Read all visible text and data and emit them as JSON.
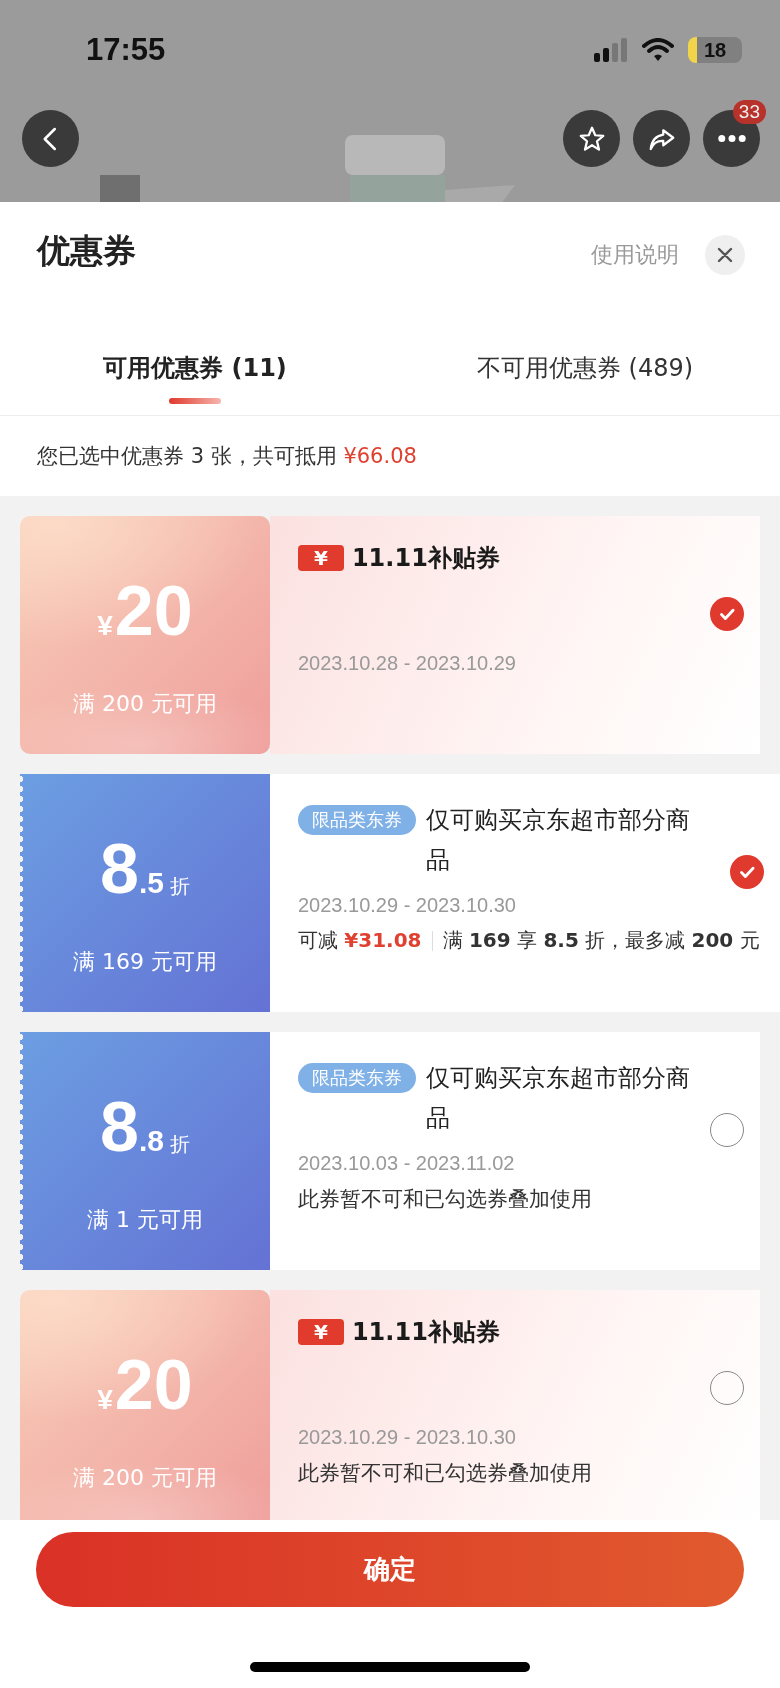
{
  "status_bar": {
    "time": "17:55",
    "battery": "18"
  },
  "nav": {
    "badge": "33"
  },
  "sheet": {
    "title": "优惠券",
    "help_link": "使用说明"
  },
  "tabs": [
    {
      "label": "可用优惠券 (11)",
      "selected": true
    },
    {
      "label": "不可用优惠券 (489)",
      "selected": false
    }
  ],
  "summary": {
    "text": "您已选中优惠券 3 张，共可抵用",
    "amount": "¥66.08"
  },
  "coupons": [
    {
      "kind": "subsidy",
      "currency": "¥",
      "value": "20",
      "condition": "满 200 元可用",
      "badge": "¥",
      "title": "11.11补贴券",
      "dates": "2023.10.28 - 2023.10.29",
      "selected": true
    },
    {
      "kind": "discount",
      "value": "8",
      "fraction": ".5",
      "unit": "折",
      "condition": "满 169 元可用",
      "tag": "限品类东券",
      "description": "仅可购买京东超市部分商品",
      "dates": "2023.10.29 - 2023.10.30",
      "saving_label": "可减",
      "saving": "¥31.08",
      "rule": "满 **169** 享 **8.5** 折，最多减 **200** 元",
      "selected": true
    },
    {
      "kind": "discount",
      "value": "8",
      "fraction": ".8",
      "unit": "折",
      "condition": "满 1 元可用",
      "tag": "限品类东券",
      "description": "仅可购买京东超市部分商品",
      "dates": "2023.10.03 - 2023.11.02",
      "note": "此券暂不可和已勾选券叠加使用",
      "selected": false
    },
    {
      "kind": "subsidy",
      "currency": "¥",
      "value": "20",
      "condition": "满 200 元可用",
      "badge": "¥",
      "title": "11.11补贴券",
      "dates": "2023.10.29 - 2023.10.30",
      "note": "此券暂不可和已勾选券叠加使用",
      "selected": false
    }
  ],
  "confirm_button": "确定"
}
